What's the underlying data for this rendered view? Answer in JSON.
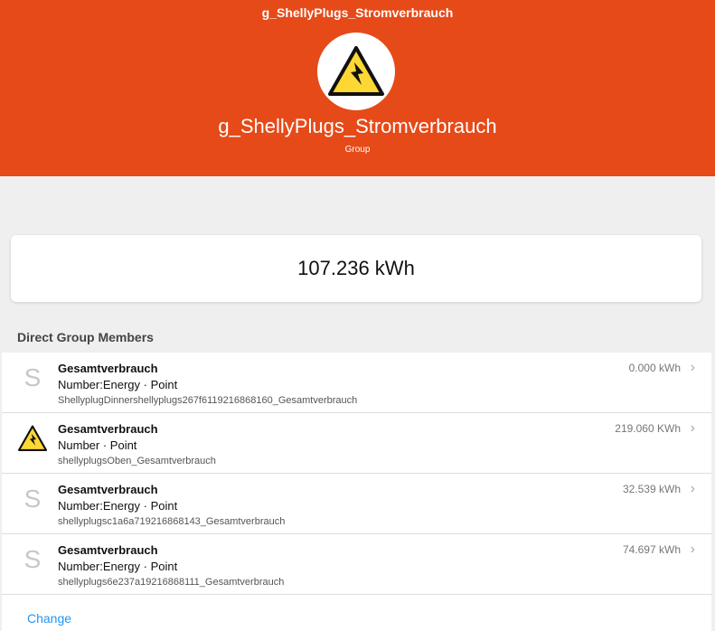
{
  "header": {
    "nav_title": "g_ShellyPlugs_Stromverbrauch",
    "title": "g_ShellyPlugs_Stromverbrauch",
    "subtitle": "Group",
    "avatar_icon": "warning-electricity-icon",
    "background_color": "#e64a19"
  },
  "state": {
    "value": "107.236 kWh"
  },
  "members_section": {
    "title": "Direct Group Members",
    "items": [
      {
        "icon": "letter-s-icon",
        "icon_text": "S",
        "name": "Gesamtverbrauch",
        "type": "Number:Energy · Point",
        "item_name": "ShellyplugDinnershellyplugs267f6119216868160_Gesamtverbrauch",
        "state": "0.000 kWh"
      },
      {
        "icon": "warning-electricity-icon",
        "icon_text": "",
        "name": "Gesamtverbrauch",
        "type": "Number · Point",
        "item_name": "shellyplugsOben_Gesamtverbrauch",
        "state": "219.060 KWh"
      },
      {
        "icon": "letter-s-icon",
        "icon_text": "S",
        "name": "Gesamtverbrauch",
        "type": "Number:Energy · Point",
        "item_name": "shellyplugsc1a6a719216868143_Gesamtverbrauch",
        "state": "32.539 kWh"
      },
      {
        "icon": "letter-s-icon",
        "icon_text": "S",
        "name": "Gesamtverbrauch",
        "type": "Number:Energy · Point",
        "item_name": "shellyplugs6e237a19216868111_Gesamtverbrauch",
        "state": "74.697 kWh"
      }
    ],
    "change_label": "Change"
  }
}
